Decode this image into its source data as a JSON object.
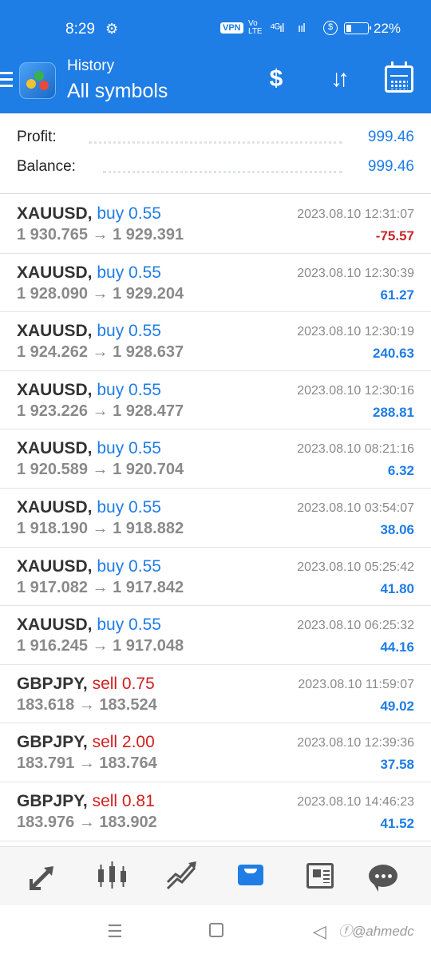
{
  "status_bar": {
    "time": "8:29",
    "vpn": "VPN",
    "volte": "Vo LTE",
    "net": "⁴ᴳıl",
    "battery_pct": "22%",
    "battery_level": 0.22
  },
  "header": {
    "subtitle": "History",
    "title": "All symbols"
  },
  "summary": {
    "profit_label": "Profit:",
    "profit_value": "999.46",
    "balance_label": "Balance:",
    "balance_value": "999.46"
  },
  "trades": [
    {
      "symbol": "XAUUSD,",
      "side": "buy 0.55",
      "type": "buy",
      "prices": "1 930.765 → 1 929.391",
      "time": "2023.08.10 12:31:07",
      "pl": "-75.57",
      "neg": true
    },
    {
      "symbol": "XAUUSD,",
      "side": "buy 0.55",
      "type": "buy",
      "prices": "1 928.090 → 1 929.204",
      "time": "2023.08.10 12:30:39",
      "pl": "61.27",
      "neg": false
    },
    {
      "symbol": "XAUUSD,",
      "side": "buy 0.55",
      "type": "buy",
      "prices": "1 924.262 → 1 928.637",
      "time": "2023.08.10 12:30:19",
      "pl": "240.63",
      "neg": false
    },
    {
      "symbol": "XAUUSD,",
      "side": "buy 0.55",
      "type": "buy",
      "prices": "1 923.226 → 1 928.477",
      "time": "2023.08.10 12:30:16",
      "pl": "288.81",
      "neg": false
    },
    {
      "symbol": "XAUUSD,",
      "side": "buy 0.55",
      "type": "buy",
      "prices": "1 920.589 → 1 920.704",
      "time": "2023.08.10 08:21:16",
      "pl": "6.32",
      "neg": false
    },
    {
      "symbol": "XAUUSD,",
      "side": "buy 0.55",
      "type": "buy",
      "prices": "1 918.190 → 1 918.882",
      "time": "2023.08.10 03:54:07",
      "pl": "38.06",
      "neg": false
    },
    {
      "symbol": "XAUUSD,",
      "side": "buy 0.55",
      "type": "buy",
      "prices": "1 917.082 → 1 917.842",
      "time": "2023.08.10 05:25:42",
      "pl": "41.80",
      "neg": false
    },
    {
      "symbol": "XAUUSD,",
      "side": "buy 0.55",
      "type": "buy",
      "prices": "1 916.245 → 1 917.048",
      "time": "2023.08.10 06:25:32",
      "pl": "44.16",
      "neg": false
    },
    {
      "symbol": "GBPJPY,",
      "side": "sell 0.75",
      "type": "sell",
      "prices": "183.618 → 183.524",
      "time": "2023.08.10 11:59:07",
      "pl": "49.02",
      "neg": false
    },
    {
      "symbol": "GBPJPY,",
      "side": "sell 2.00",
      "type": "sell",
      "prices": "183.791 → 183.764",
      "time": "2023.08.10 12:39:36",
      "pl": "37.58",
      "neg": false
    },
    {
      "symbol": "GBPJPY,",
      "side": "sell 0.81",
      "type": "sell",
      "prices": "183.976 → 183.902",
      "time": "2023.08.10 14:46:23",
      "pl": "41.52",
      "neg": false
    }
  ],
  "bottom_nav": {
    "items": [
      {
        "name": "quotes",
        "icon": "trade-arrows-icon"
      },
      {
        "name": "chart",
        "icon": "candlestick-icon"
      },
      {
        "name": "trade",
        "icon": "trend-icon"
      },
      {
        "name": "history",
        "icon": "inbox-tray-icon",
        "active": true
      },
      {
        "name": "news",
        "icon": "newspaper-icon"
      },
      {
        "name": "messages",
        "icon": "chat-bubble-icon"
      }
    ]
  },
  "watermark": "ⓕ@ahmedc",
  "colors": {
    "primary": "#1f7de6",
    "buy": "#1f7de6",
    "sell": "#d21f1f",
    "loss": "#c4282a",
    "muted": "#8a8a8a"
  }
}
